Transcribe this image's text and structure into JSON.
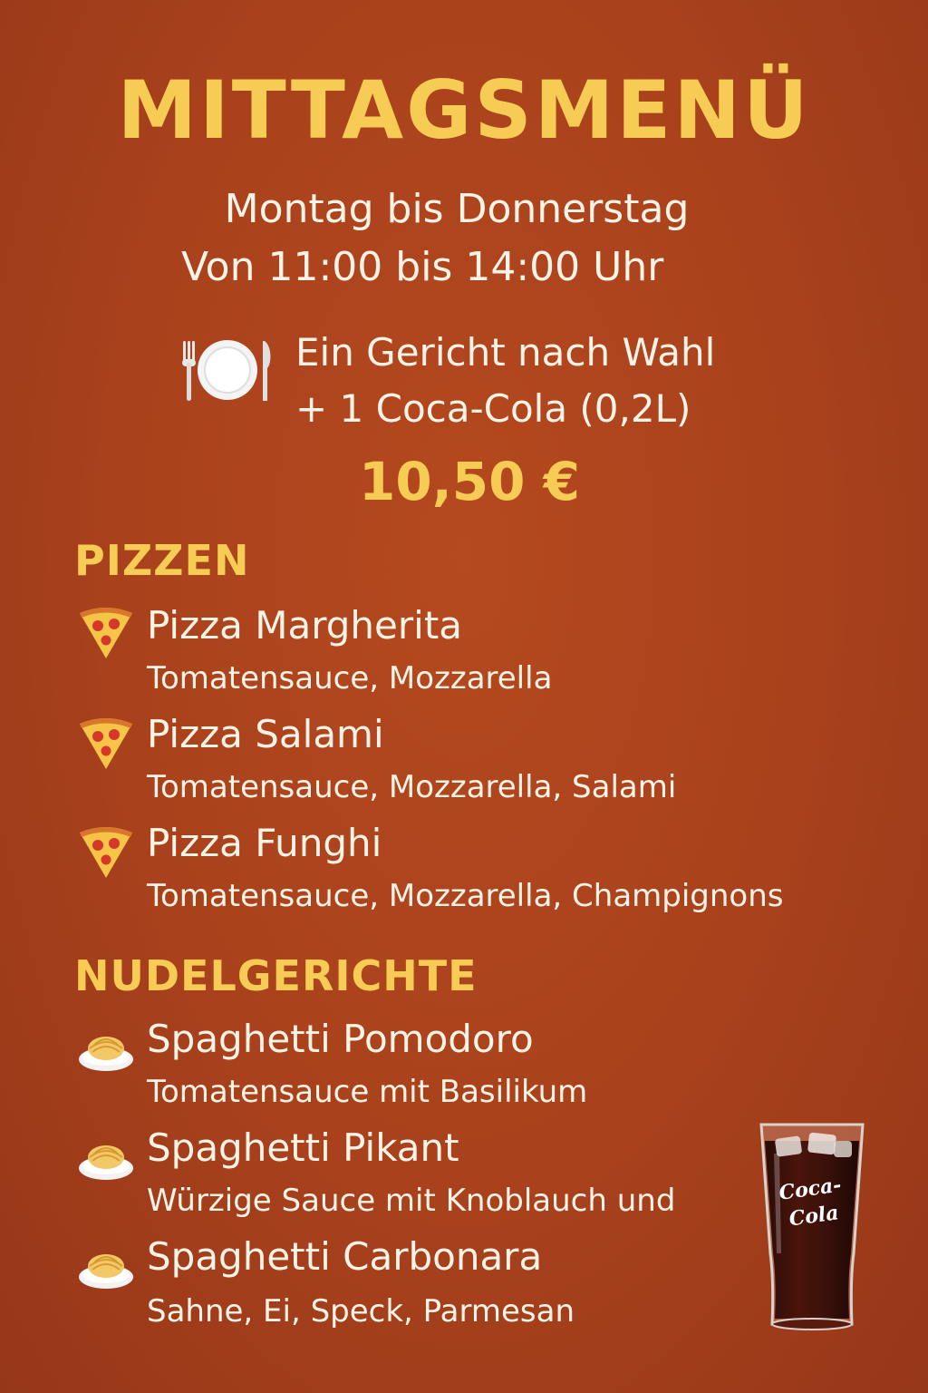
{
  "header": {
    "title": "MITTAGSMENÜ",
    "days": "Montag bis Donnerstag",
    "hours": "Von 11:00 bis 14:00 Uhr"
  },
  "offer": {
    "icon": "plate-cutlery-icon",
    "line1": "Ein Gericht nach Wahl",
    "line2": "+ 1 Coca-Cola (0,2L)",
    "price": "10,50 €"
  },
  "sections": [
    {
      "title": "PIZZEN",
      "icon": "pizza-slice-icon",
      "items": [
        {
          "name": "Pizza Margherita",
          "desc": "Tomatensauce, Mozzarella"
        },
        {
          "name": "Pizza Salami",
          "desc": "Tomatensauce, Mozzarella, Salami"
        },
        {
          "name": "Pizza Funghi",
          "desc": "Tomatensauce, Mozzarella, Champignons"
        }
      ]
    },
    {
      "title": "NUDELGERICHTE",
      "icon": "spaghetti-plate-icon",
      "items": [
        {
          "name": "Spaghetti Pomodoro",
          "desc": "Tomatensauce mit Basilikum"
        },
        {
          "name": "Spaghetti Pikant",
          "desc": "Würzige Sauce mit Knoblauch und"
        },
        {
          "name": "Spaghetti Carbonara",
          "desc": "Sahne, Ei, Speck, Parmesan"
        }
      ]
    }
  ],
  "drink_image": {
    "icon": "cola-glass-icon",
    "logo_text": "Coca-Cola"
  },
  "colors": {
    "background": "#a8411c",
    "accent": "#f7cc55",
    "text": "#fbf3e6"
  }
}
